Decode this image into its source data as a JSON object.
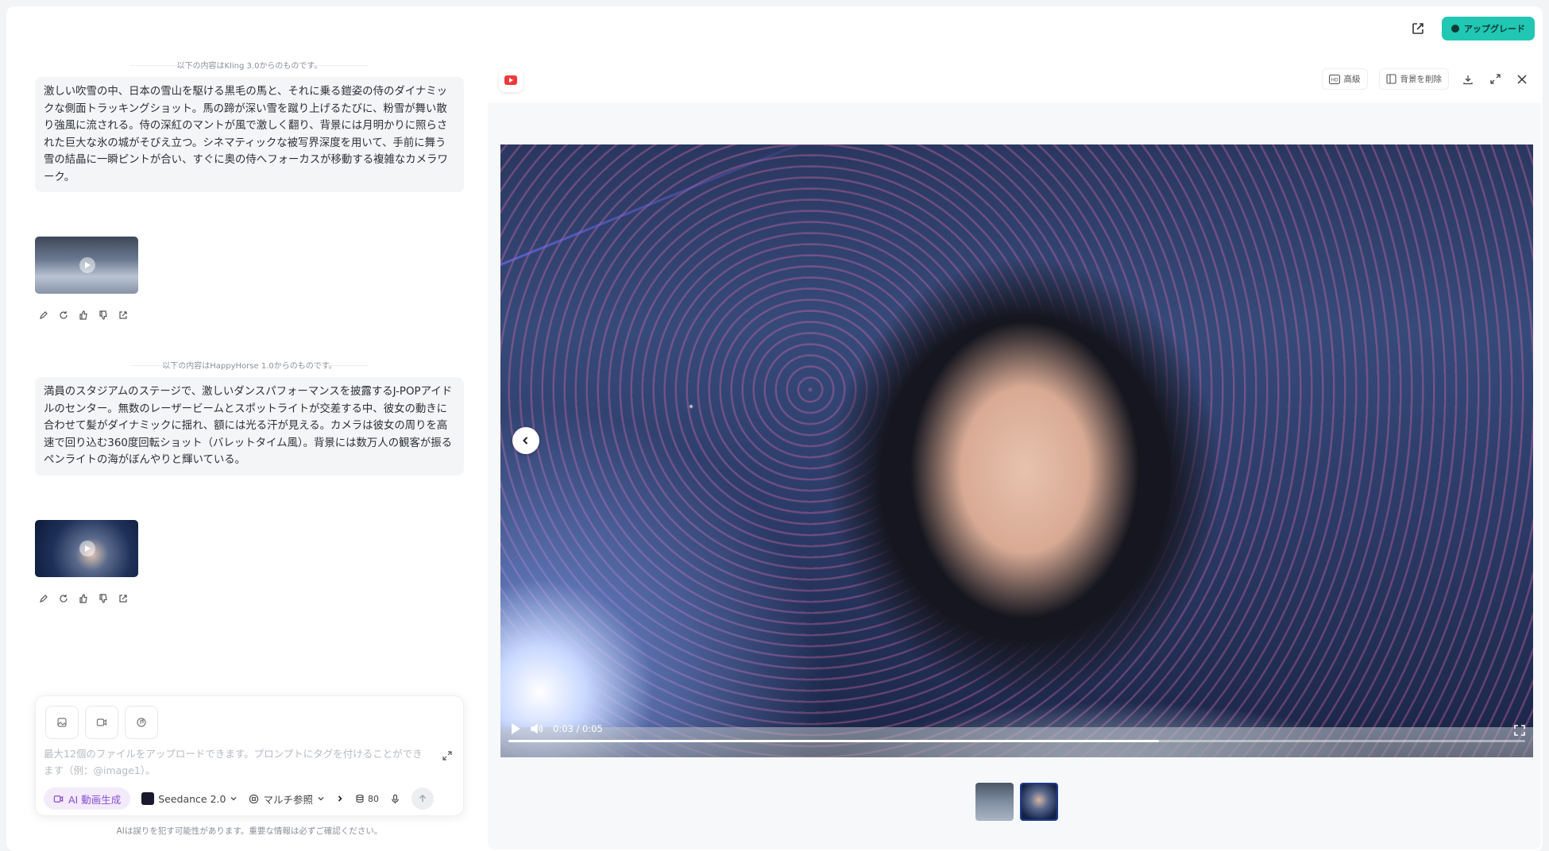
{
  "topbar": {
    "share_icon": "share-icon",
    "upgrade_label": "アップグレード"
  },
  "chat": {
    "messages": [
      {
        "source": "以下の内容はKling 3.0からのものです。",
        "prompt": "激しい吹雪の中、日本の雪山を駆ける黒毛の馬と、それに乗る鎧姿の侍のダイナミックな側面トラッキングショット。馬の蹄が深い雪を蹴り上げるたびに、粉雪が舞い散り強風に流される。侍の深紅のマントが風で激しく翻り、背景には月明かりに照らされた巨大な氷の城がそびえ立つ。シネマティックな被写界深度を用いて、手前に舞う雪の結晶に一瞬ピントが合い、すぐに奥の侍へフォーカスが移動する複雑なカメラワーク。"
      },
      {
        "source": "以下の内容はHappyHorse 1.0からのものです。",
        "prompt": "満員のスタジアムのステージで、激しいダンスパフォーマンスを披露するJ-POPアイドルのセンター。無数のレーザービームとスポットライトが交差する中、彼女の動きに合わせて髪がダイナミックに揺れ、額には光る汗が見える。カメラは彼女の周りを高速で回り込む360度回転ショット（バレットタイム風）。背景には数万人の観客が振るペンライトの海がぼんやりと輝いている。"
      }
    ],
    "action_icons": [
      "edit-icon",
      "refresh-icon",
      "thumbs-up-icon",
      "thumbs-down-icon",
      "share-icon"
    ]
  },
  "composer": {
    "placeholder": "最大12個のファイルをアップロードできます。プロンプトにタグを付けることができます（例：@image1）。",
    "mode_label": "AI 動画生成",
    "model_label": "Seedance 2.0",
    "reference_label": "マルチ参照",
    "credits": "80",
    "disclaimer": "AIは誤りを犯す可能性があります。重要な情報は必ずご確認ください。"
  },
  "viewer": {
    "hd_label": "高級",
    "remove_bg_label": "背景を削除",
    "time": "0:03 / 0:05",
    "progress": 0.64,
    "accent": "#21c7b2"
  }
}
